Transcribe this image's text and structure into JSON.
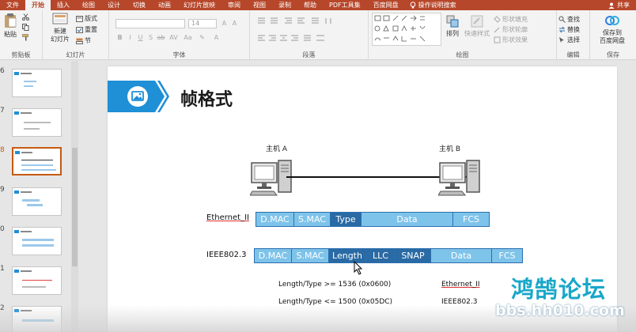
{
  "menu": {
    "tabs": [
      "文件",
      "开始",
      "插入",
      "绘图",
      "设计",
      "切换",
      "动画",
      "幻灯片放映",
      "审阅",
      "视图",
      "录制",
      "帮助",
      "PDF工具集",
      "百度网盘"
    ],
    "active_tab": "开始",
    "tell_me": "操作说明搜索",
    "share": "共享"
  },
  "ribbon": {
    "clipboard": {
      "paste": "粘贴",
      "label": "剪贴板"
    },
    "slides": {
      "new_slide": "新建\n幻灯片",
      "layout": "版式",
      "reset": "重置",
      "section": "节",
      "label": "幻灯片"
    },
    "font": {
      "font_size": "14",
      "label": "字体"
    },
    "paragraph": {
      "label": "段落"
    },
    "drawing": {
      "arrange": "排列",
      "quick_styles": "快速样式",
      "fill": "形状填充",
      "outline": "形状轮廓",
      "effects": "形状效果",
      "label": "绘图"
    },
    "editing": {
      "find": "查找",
      "replace": "替换",
      "select": "选择",
      "label": "编辑"
    },
    "save": {
      "save_baidu": "保存到\n百度网盘",
      "label": "保存"
    }
  },
  "thumbnails": {
    "numbers": [
      "6",
      "7",
      "8",
      "9",
      "0",
      "1",
      "2"
    ],
    "selected": "8"
  },
  "slide": {
    "title": "帧格式",
    "host_a": "主机 A",
    "host_b": "主机 B",
    "ethernet_row": {
      "label": "Ethernet_II",
      "fields": [
        "D.MAC",
        "S.MAC",
        "Type",
        "Data",
        "FCS"
      ]
    },
    "ieee_row": {
      "label": "IEEE802.3",
      "fields": [
        "D.MAC",
        "S.MAC",
        "Length",
        "LLC",
        "SNAP",
        "Data",
        "FCS"
      ]
    },
    "notes": [
      {
        "rule": "Length/Type >= 1536 (0x0600)",
        "result": "Ethernet_II"
      },
      {
        "rule": "Length/Type <= 1500 (0x05DC)",
        "result": "IEEE802.3"
      }
    ]
  },
  "watermark": {
    "name": "鸿鹄论坛",
    "url": "bbs.hh010.com"
  },
  "colors": {
    "accent": "#b7472a",
    "field_light": "#7ec3ea",
    "field_dark": "#2a6aa5",
    "badge_blue": "#1f8fd6",
    "watermark": "#19a7c9"
  }
}
